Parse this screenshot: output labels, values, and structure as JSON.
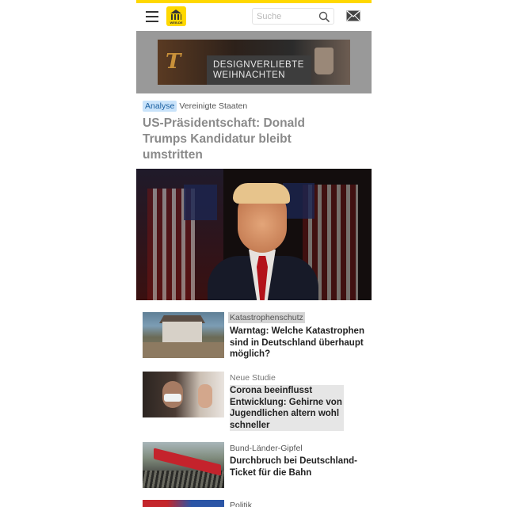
{
  "header": {
    "logo_text": "WEB.DE",
    "search_placeholder": "Suche"
  },
  "banner": {
    "slogan_line1": "DESIGNVERLIEBTE",
    "slogan_line2": "WEIHNACHTEN"
  },
  "lead": {
    "badge": "Analyse",
    "topic": "Vereinigte Staaten",
    "title": "US-Präsidentschaft: Donald Trumps Kandidatur bleibt umstritten"
  },
  "articles": [
    {
      "kicker": "Katastrophenschutz",
      "headline": "Warntag: Welche Katastrophen sind in Deutschland überhaupt möglich?"
    },
    {
      "kicker": "Neue Studie",
      "headline": "Corona beeinflusst Entwicklung: Gehirne von Jugendlichen altern wohl schneller"
    },
    {
      "kicker": "Bund-Länder-Gipfel",
      "headline": "Durchbruch bei Deutschland-Ticket für die Bahn"
    },
    {
      "kicker": "Politik",
      "headline": ""
    }
  ],
  "colors": {
    "brand_yellow": "#ffd800",
    "badge_bg": "#c9e3fa",
    "badge_text": "#1a5fa0",
    "banner_gray": "#999999"
  },
  "icons": {
    "menu": "hamburger-icon",
    "search": "search-icon",
    "mail": "mail-icon"
  }
}
